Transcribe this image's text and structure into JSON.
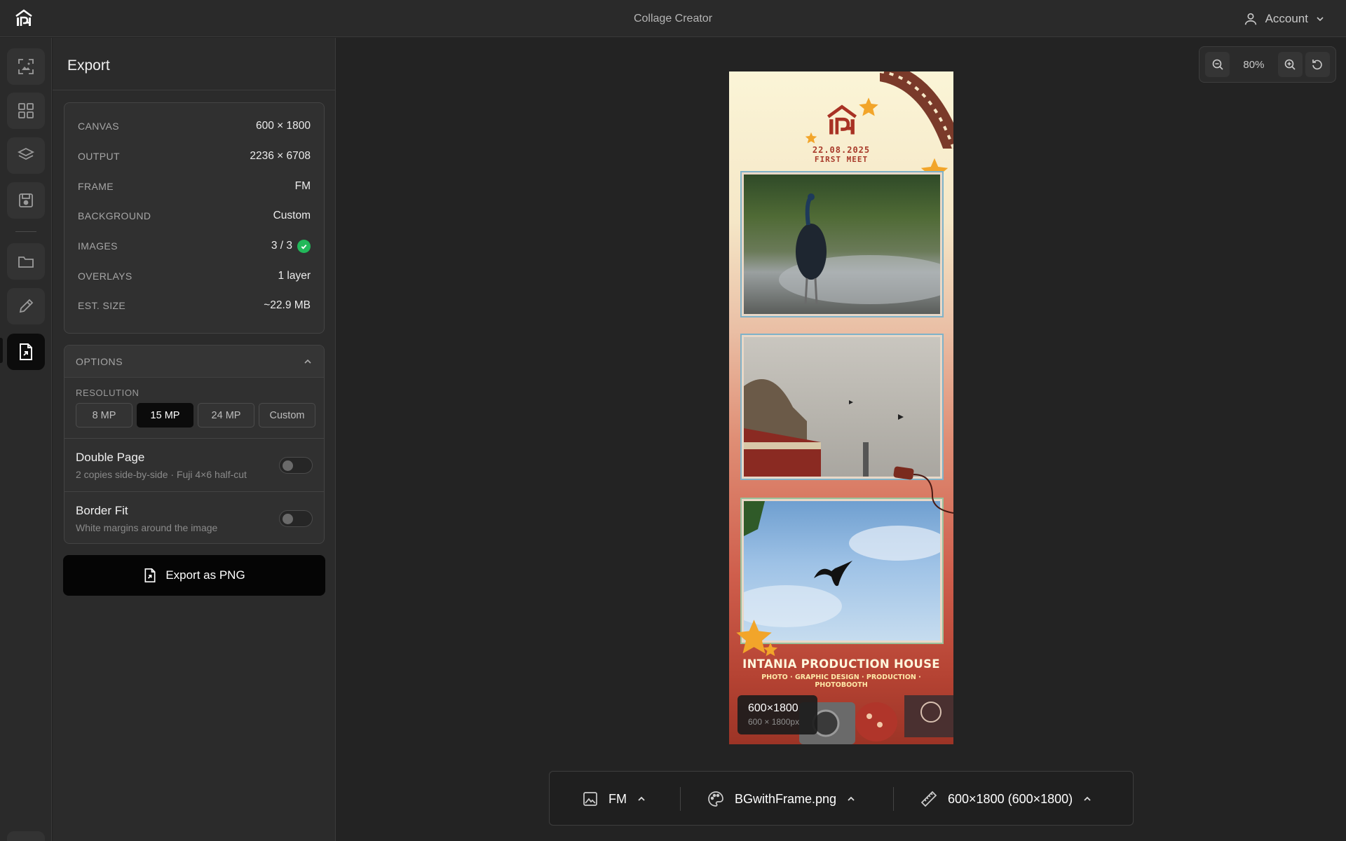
{
  "app": {
    "title": "Collage Creator",
    "account_label": "Account"
  },
  "rail": {
    "items": [
      "image-edit-icon",
      "grid-icon",
      "layers-icon",
      "save-icon",
      "folder-icon",
      "pencil-icon",
      "export-file-icon"
    ],
    "active": "export-file-icon",
    "help": "help-icon"
  },
  "panel": {
    "title": "Export",
    "info": [
      {
        "label": "CANVAS",
        "value": "600 × 1800"
      },
      {
        "label": "OUTPUT",
        "value": "2236 × 6708"
      },
      {
        "label": "FRAME",
        "value": "FM"
      },
      {
        "label": "BACKGROUND",
        "value": "Custom"
      },
      {
        "label": "IMAGES",
        "value": "3 / 3"
      },
      {
        "label": "OVERLAYS",
        "value": "1 layer"
      },
      {
        "label": "EST. SIZE",
        "value": "~22.9 MB"
      }
    ],
    "options": {
      "title": "OPTIONS",
      "resolution_label": "RESOLUTION",
      "resolutions": [
        "8 MP",
        "15 MP",
        "24 MP",
        "Custom"
      ],
      "selected_resolution": "15 MP",
      "double_page": {
        "title": "Double Page",
        "desc": "2 copies side-by-side · Fuji 4×6 half-cut",
        "on": false
      },
      "border_fit": {
        "title": "Border Fit",
        "desc": "White margins around the image",
        "on": false
      }
    },
    "export_label": "Export as PNG"
  },
  "zoom": {
    "value": "80%"
  },
  "canvas": {
    "date_line1": "22.08.2025",
    "date_line2": "FIRST MEET",
    "title": "INTANIA PRODUCTION HOUSE",
    "subtitle": "PHOTO · GRAPHIC DESIGN · PRODUCTION · PHOTOBOOTH",
    "badge_main": "600×1800",
    "badge_sub": "600 × 1800px"
  },
  "bottombar": {
    "frame": "FM",
    "background": "BGwithFrame.png",
    "size": "600×1800 (600×1800)"
  },
  "colors": {
    "accent_check": "#22b85a",
    "active_bg": "#0b0b0b"
  }
}
